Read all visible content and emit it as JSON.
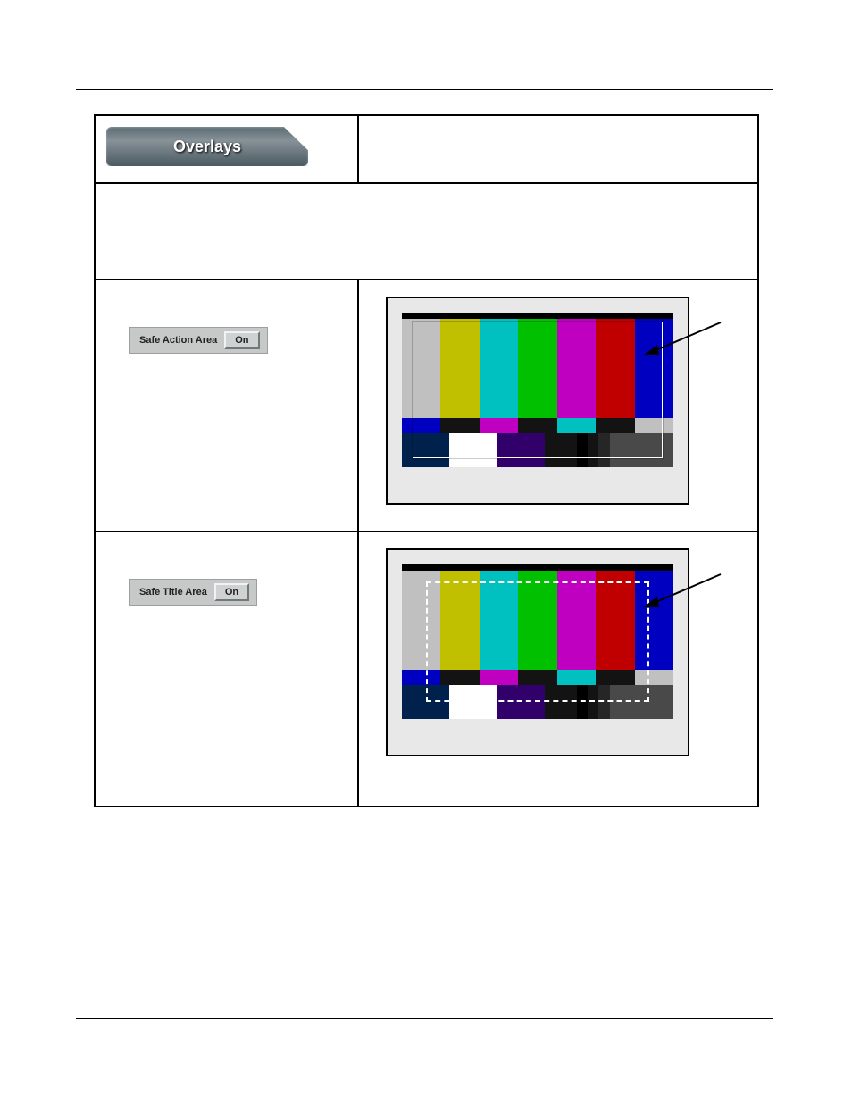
{
  "tab": {
    "label": "Overlays"
  },
  "rows": {
    "safe_action": {
      "label": "Safe Action Area",
      "button": "On"
    },
    "safe_title": {
      "label": "Safe Title Area",
      "button": "On"
    }
  }
}
